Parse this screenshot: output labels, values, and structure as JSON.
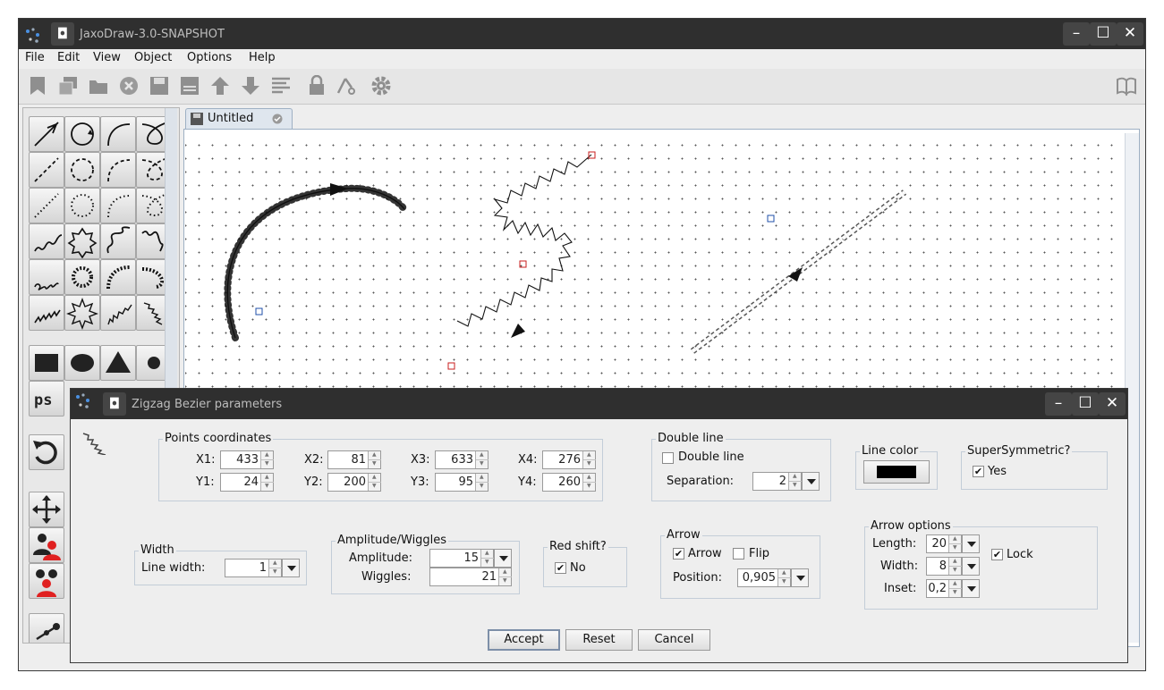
{
  "app": {
    "title": "JaxoDraw-3.0-SNAPSHOT"
  },
  "menubar": [
    "File",
    "Edit",
    "View",
    "Object",
    "Options",
    "Help"
  ],
  "toolbar_icons": [
    "new-bookmark-icon",
    "duplicate-icon",
    "open-folder-icon",
    "close-icon",
    "save-icon",
    "save-as-icon",
    "move-up-icon",
    "move-down-icon",
    "align-icon",
    "lock-icon",
    "cut-icon",
    "settings-icon",
    "manual-book-icon"
  ],
  "tab": {
    "label": "Untitled"
  },
  "dialog": {
    "title": "Zigzag Bezier parameters",
    "points": {
      "title": "Points coordinates",
      "x_labels": [
        "X1:",
        "X2:",
        "X3:",
        "X4:"
      ],
      "y_labels": [
        "Y1:",
        "Y2:",
        "Y3:",
        "Y4:"
      ],
      "x_values": [
        "433",
        "81",
        "633",
        "276"
      ],
      "y_values": [
        "24",
        "200",
        "95",
        "260"
      ]
    },
    "double_line": {
      "title": "Double line",
      "checkbox_label": "Double line",
      "checked": false,
      "separation_label": "Separation:",
      "separation_value": "2"
    },
    "line_color": {
      "title": "Line color",
      "color": "#000000"
    },
    "supersymmetric": {
      "title": "SuperSymmetric?",
      "label": "Yes",
      "checked": true
    },
    "width": {
      "title": "Width",
      "label": "Line width:",
      "value": "1"
    },
    "amplitude": {
      "title": "Amplitude/Wiggles",
      "amp_label": "Amplitude:",
      "amp_value": "15",
      "wig_label": "Wiggles:",
      "wig_value": "21"
    },
    "red_shift": {
      "title": "Red shift?",
      "label": "No",
      "checked": true
    },
    "arrow": {
      "title": "Arrow",
      "arrow_label": "Arrow",
      "arrow_checked": true,
      "flip_label": "Flip",
      "flip_checked": false,
      "position_label": "Position:",
      "position_value": "0,905"
    },
    "arrow_options": {
      "title": "Arrow options",
      "length_label": "Length:",
      "length_value": "20",
      "width_label": "Width:",
      "width_value": "8",
      "inset_label": "Inset:",
      "inset_value": "0,2",
      "lock_label": "Lock",
      "lock_checked": true
    },
    "buttons": {
      "accept": "Accept",
      "reset": "Reset",
      "cancel": "Cancel"
    }
  }
}
